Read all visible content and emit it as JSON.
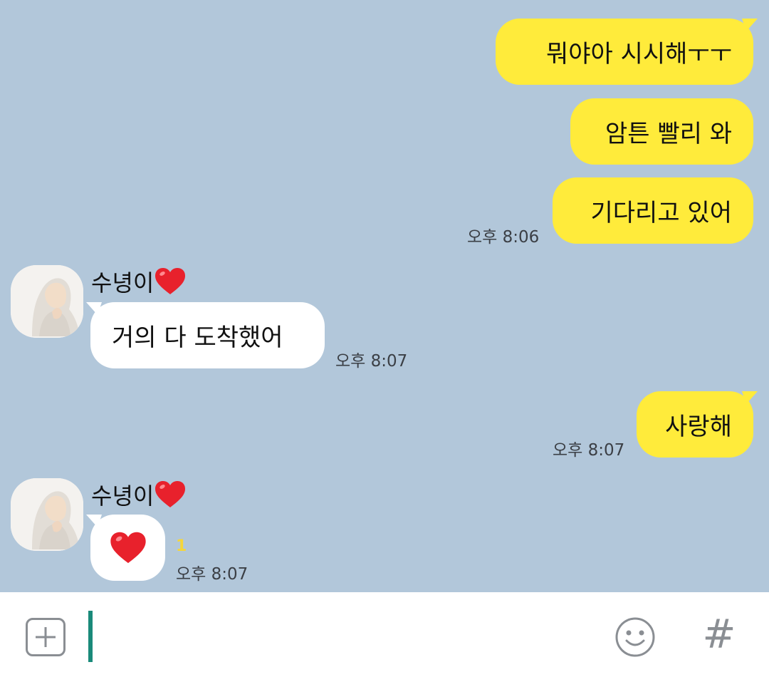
{
  "messages": [
    {
      "side": "me",
      "text": "뭐야아 시시해ㅜㅜ"
    },
    {
      "side": "me",
      "text": "암튼 빨리 와"
    },
    {
      "side": "me",
      "text": "기다리고 있어",
      "time": "오후 8:06"
    },
    {
      "side": "other",
      "sender": "수녕이",
      "text": "거의 다 도착했어",
      "time": "오후 8:07"
    },
    {
      "side": "me",
      "text": "사랑해",
      "time": "오후 8:07"
    },
    {
      "side": "other",
      "sender": "수녕이",
      "text": "❤️",
      "time": "오후 8:07",
      "unread": "1"
    }
  ],
  "input": {
    "value": "",
    "plus_icon": "plus-icon",
    "emoji_icon": "emoji-smile-icon",
    "hash_label": "#"
  },
  "colors": {
    "background": "#b2c7da",
    "my_bubble": "#ffeb3b",
    "other_bubble": "#ffffff",
    "caret": "#1a8a7a",
    "unread": "#f5d63a"
  }
}
